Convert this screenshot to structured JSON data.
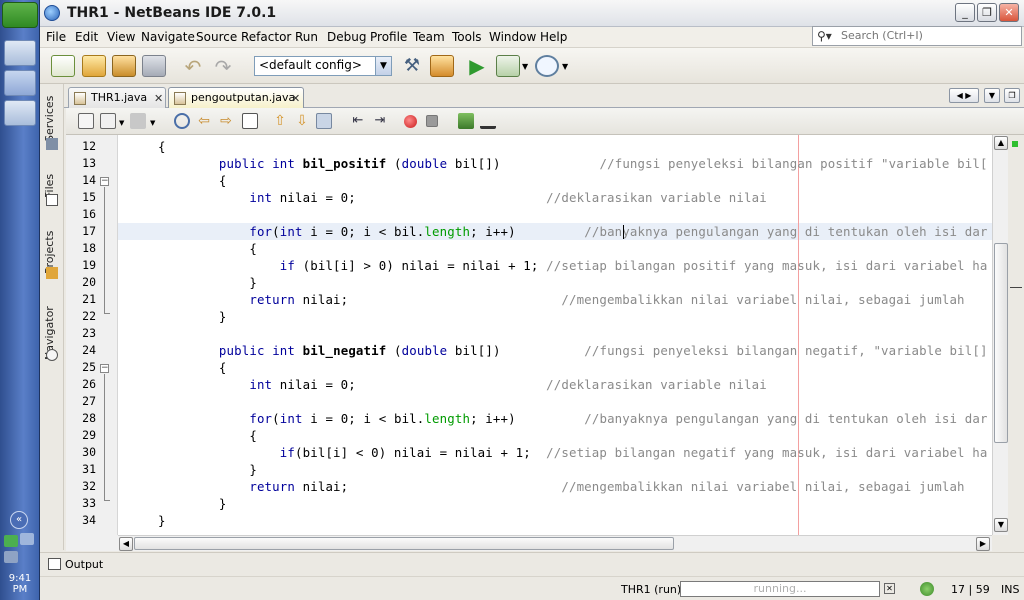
{
  "window": {
    "title": "THR1 - NetBeans IDE 7.0.1"
  },
  "taskbar": {
    "clock": "9:41 PM"
  },
  "menu": [
    "File",
    "Edit",
    "View",
    "Navigate",
    "Source",
    "Refactor",
    "Run",
    "Debug",
    "Profile",
    "Team",
    "Tools",
    "Window",
    "Help"
  ],
  "search": {
    "placeholder": "Search (Ctrl+I)"
  },
  "toolbar": {
    "config": "<default config>"
  },
  "side_tabs": [
    "Services",
    "Files",
    "Projects",
    "Navigator"
  ],
  "editor_tabs": [
    {
      "label": "THR1.java",
      "active": false
    },
    {
      "label": "pengoutputan.java",
      "active": true
    }
  ],
  "code": {
    "line_numbers": [
      "12",
      "13",
      "14",
      "15",
      "16",
      "17",
      "18",
      "19",
      "20",
      "21",
      "22",
      "23",
      "24",
      "25",
      "26",
      "27",
      "28",
      "29",
      "30",
      "31",
      "32",
      "33",
      "34"
    ],
    "lines": [
      [
        {
          "t": "{"
        }
      ],
      [
        {
          "t": "        "
        },
        {
          "t": "public",
          "c": "kw"
        },
        {
          "t": " "
        },
        {
          "t": "int",
          "c": "kw"
        },
        {
          "t": " "
        },
        {
          "t": "bil_positif",
          "c": "bold"
        },
        {
          "t": " ("
        },
        {
          "t": "double",
          "c": "kw"
        },
        {
          "t": " bil[])             "
        },
        {
          "t": "//fungsi penyeleksi bilangan positif \"variable bil[",
          "c": "cm"
        }
      ],
      [
        {
          "t": "        {"
        }
      ],
      [
        {
          "t": "            "
        },
        {
          "t": "int",
          "c": "kw"
        },
        {
          "t": " nilai = 0;                         "
        },
        {
          "t": "//deklarasikan variable nilai",
          "c": "cm"
        }
      ],
      [
        {
          "t": ""
        }
      ],
      [
        {
          "t": "            "
        },
        {
          "t": "for",
          "c": "kw"
        },
        {
          "t": "("
        },
        {
          "t": "int",
          "c": "kw"
        },
        {
          "t": " i = 0; i < bil."
        },
        {
          "t": "length",
          "c": "fld"
        },
        {
          "t": "; i++)         "
        },
        {
          "t": "//banyaknya pengulangan yang di tentukan oleh isi dar",
          "c": "cm"
        }
      ],
      [
        {
          "t": "            {"
        }
      ],
      [
        {
          "t": "                "
        },
        {
          "t": "if",
          "c": "kw"
        },
        {
          "t": " (bil[i] > 0) nilai = nilai + 1; "
        },
        {
          "t": "//setiap bilangan positif yang masuk, isi dari variabel ha",
          "c": "cm"
        }
      ],
      [
        {
          "t": "            }"
        }
      ],
      [
        {
          "t": "            "
        },
        {
          "t": "return",
          "c": "kw"
        },
        {
          "t": " nilai;                            "
        },
        {
          "t": "//mengembalikkan nilai variabel nilai, sebagai jumlah",
          "c": "cm"
        }
      ],
      [
        {
          "t": "        }"
        }
      ],
      [
        {
          "t": ""
        }
      ],
      [
        {
          "t": "        "
        },
        {
          "t": "public",
          "c": "kw"
        },
        {
          "t": " "
        },
        {
          "t": "int",
          "c": "kw"
        },
        {
          "t": " "
        },
        {
          "t": "bil_negatif",
          "c": "bold"
        },
        {
          "t": " ("
        },
        {
          "t": "double",
          "c": "kw"
        },
        {
          "t": " bil[])           "
        },
        {
          "t": "//fungsi penyeleksi bilangan negatif, \"variable bil[]",
          "c": "cm"
        }
      ],
      [
        {
          "t": "        {"
        }
      ],
      [
        {
          "t": "            "
        },
        {
          "t": "int",
          "c": "kw"
        },
        {
          "t": " nilai = 0;                         "
        },
        {
          "t": "//deklarasikan variable nilai",
          "c": "cm"
        }
      ],
      [
        {
          "t": ""
        }
      ],
      [
        {
          "t": "            "
        },
        {
          "t": "for",
          "c": "kw"
        },
        {
          "t": "("
        },
        {
          "t": "int",
          "c": "kw"
        },
        {
          "t": " i = 0; i < bil."
        },
        {
          "t": "length",
          "c": "fld"
        },
        {
          "t": "; i++)         "
        },
        {
          "t": "//banyaknya pengulangan yang di tentukan oleh isi dar",
          "c": "cm"
        }
      ],
      [
        {
          "t": "            {"
        }
      ],
      [
        {
          "t": "                "
        },
        {
          "t": "if",
          "c": "kw"
        },
        {
          "t": "(bil[i] < 0) nilai = nilai + 1;  "
        },
        {
          "t": "//setiap bilangan negatif yang masuk, isi dari variabel ha",
          "c": "cm"
        }
      ],
      [
        {
          "t": "            }"
        }
      ],
      [
        {
          "t": "            "
        },
        {
          "t": "return",
          "c": "kw"
        },
        {
          "t": " nilai;                            "
        },
        {
          "t": "//mengembalikkan nilai variabel nilai, sebagai jumlah",
          "c": "cm"
        }
      ],
      [
        {
          "t": "        }"
        }
      ],
      [
        {
          "t": "}"
        }
      ]
    ]
  },
  "output": {
    "label": "Output"
  },
  "status": {
    "run": "THR1 (run)",
    "progress": "running...",
    "position": "17 | 59",
    "mode": "INS"
  }
}
